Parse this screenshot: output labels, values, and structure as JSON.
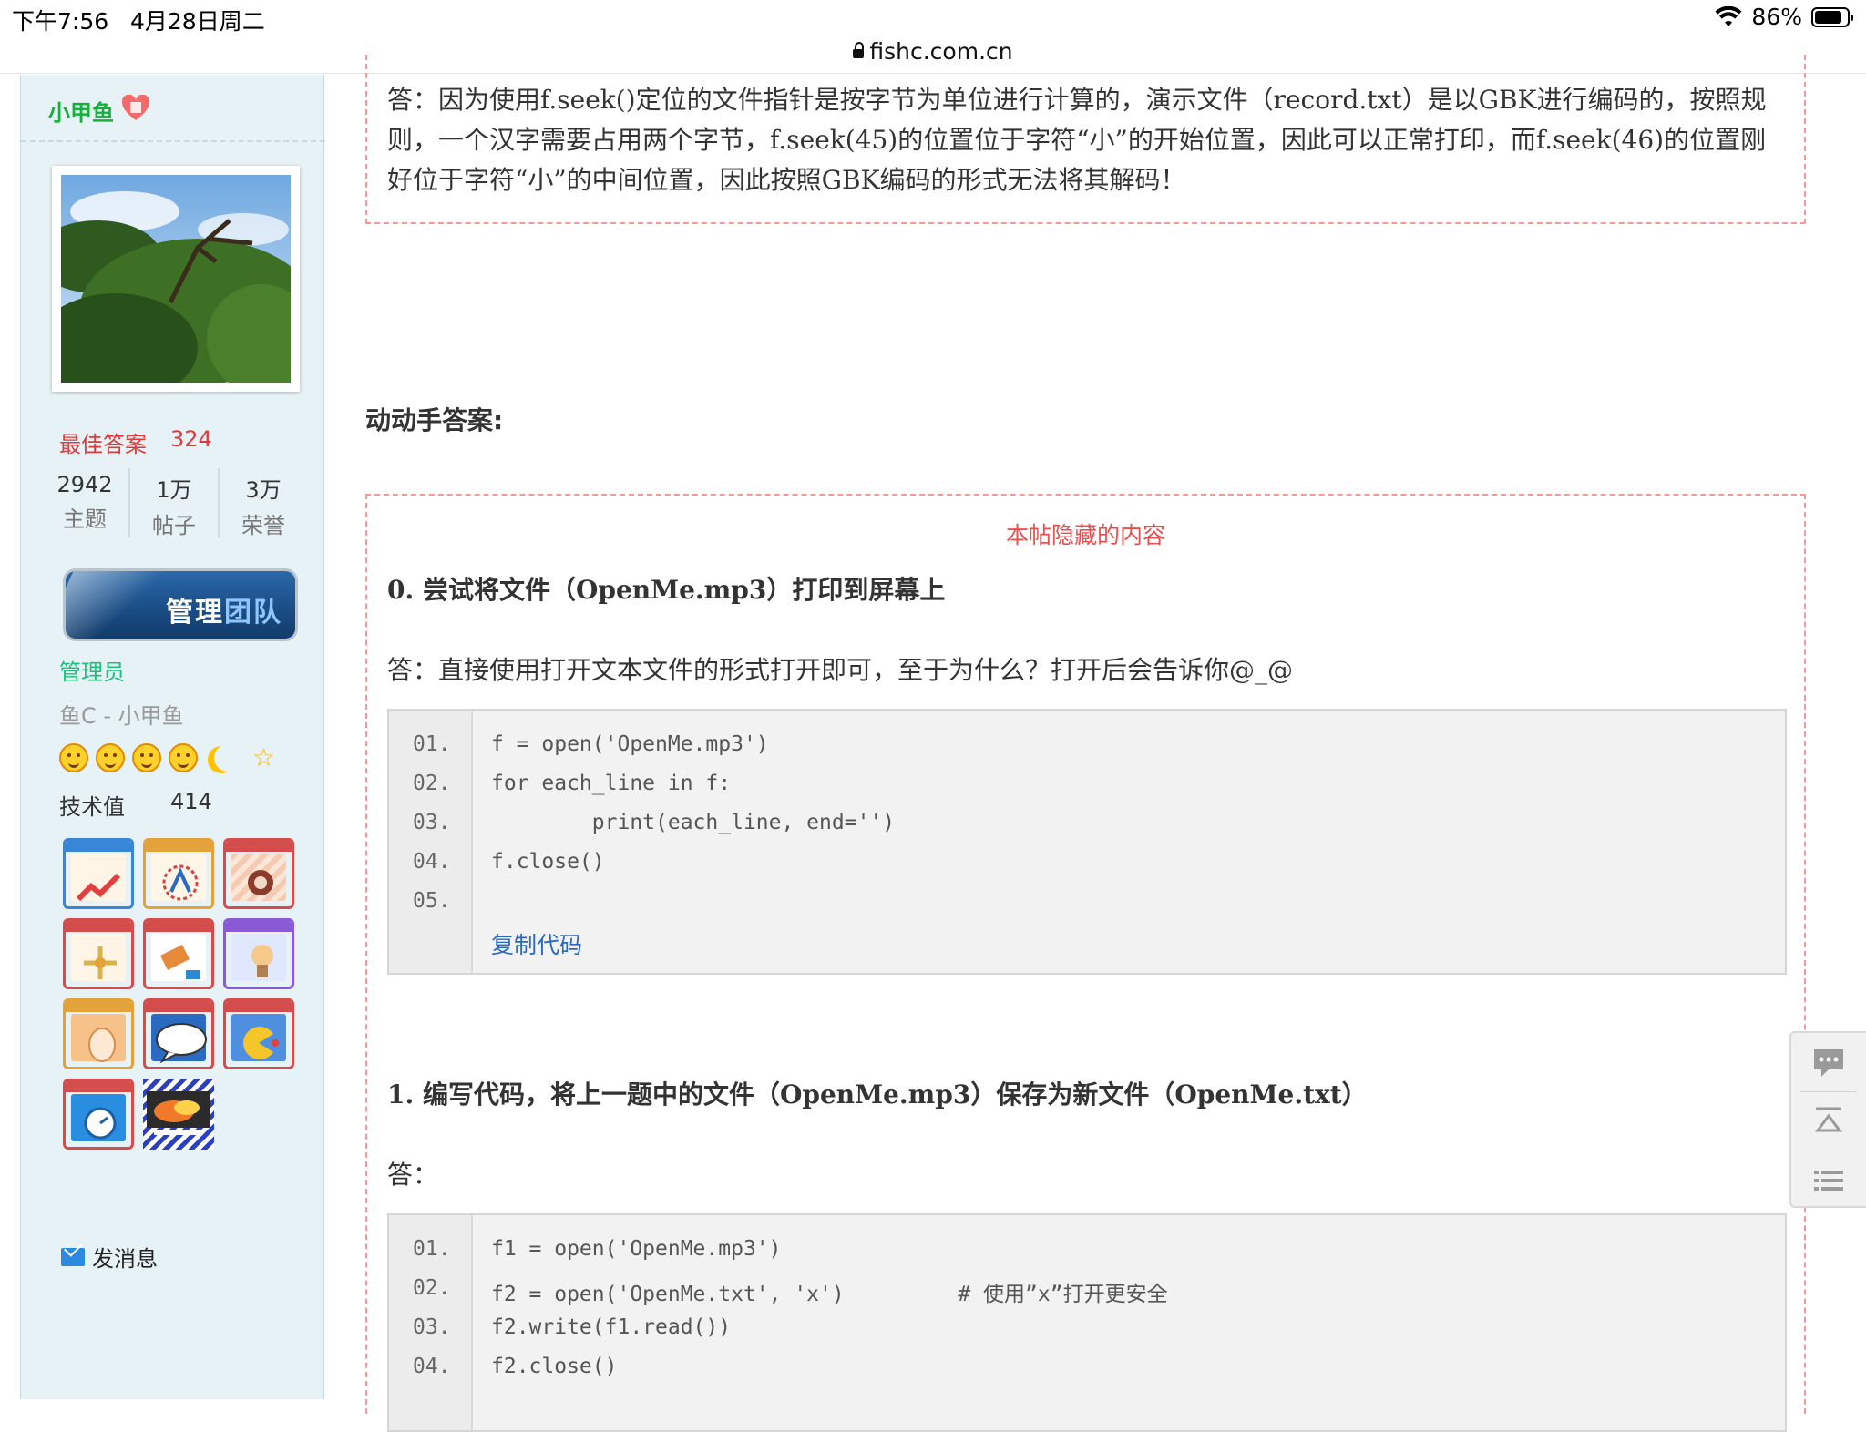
{
  "status_bar": {
    "time": "下午7:56",
    "date": "4月28日周二",
    "battery": "86%",
    "battery_level": 0.86
  },
  "browser": {
    "url": "fishc.com.cn"
  },
  "sidebar": {
    "username": "小甲鱼",
    "best_answer_label": "最佳答案",
    "best_answer_value": "324",
    "stats": [
      {
        "value": "2942",
        "label": "主题"
      },
      {
        "value": "1万",
        "label": "帖子"
      },
      {
        "value": "3万",
        "label": "荣誉"
      }
    ],
    "team_button": {
      "part1": "管理",
      "part2": "团队"
    },
    "role": "管理员",
    "motto": "鱼C - 小甲鱼",
    "tech_label": "技术值",
    "tech_value": "414",
    "send_message": "发消息",
    "medal_icons": [
      "chart-medal-icon",
      "atom-medal-icon",
      "shield-medal-icon",
      "cross-medal-icon",
      "pen-medal-icon",
      "bulb-medal-icon",
      "egg-medal-icon",
      "speech-medal-icon",
      "pacman-medal-icon",
      "clock-medal-icon",
      "fire-medal-icon"
    ]
  },
  "content": {
    "prev_answer": "答：因为使用f.seek()定位的文件指针是按字节为单位进行计算的，演示文件（record.txt）是以GBK进行编码的，按照规则，一个汉字需要占用两个字节，f.seek(45)的位置位于字符“小”的开始位置，因此可以正常打印，而f.seek(46)的位置刚好位于字符“小”的中间位置，因此按照GBK编码的形式无法将其解码！",
    "section_title": "动动手答案:",
    "hidden_note": "本帖隐藏的内容",
    "q0": "0. 尝试将文件（OpenMe.mp3）打印到屏幕上",
    "a0": "答：直接使用打开文本文件的形式打开即可，至于为什么？打开后会告诉你@_@",
    "code0": {
      "line_numbers": [
        "01.",
        "02.",
        "03.",
        "04.",
        "05."
      ],
      "lines": [
        "f = open('OpenMe.mp3')",
        "for each_line in f:",
        "        print(each_line, end='')",
        "f.close()",
        ""
      ],
      "copy_label": "复制代码"
    },
    "q1": "1. 编写代码，将上一题中的文件（OpenMe.mp3）保存为新文件（OpenMe.txt）",
    "a1": "答：",
    "code1": {
      "line_numbers": [
        "01.",
        "02.",
        "03.",
        "04."
      ],
      "lines": [
        "f1 = open('OpenMe.mp3')",
        "f2 = open('OpenMe.txt', 'x')         # 使用”x”打开更安全",
        "f2.write(f1.read())",
        "f2.close()"
      ]
    }
  },
  "floating_toolbar": {
    "icons": [
      "comment-icon",
      "back-to-top-icon",
      "list-icon"
    ]
  }
}
